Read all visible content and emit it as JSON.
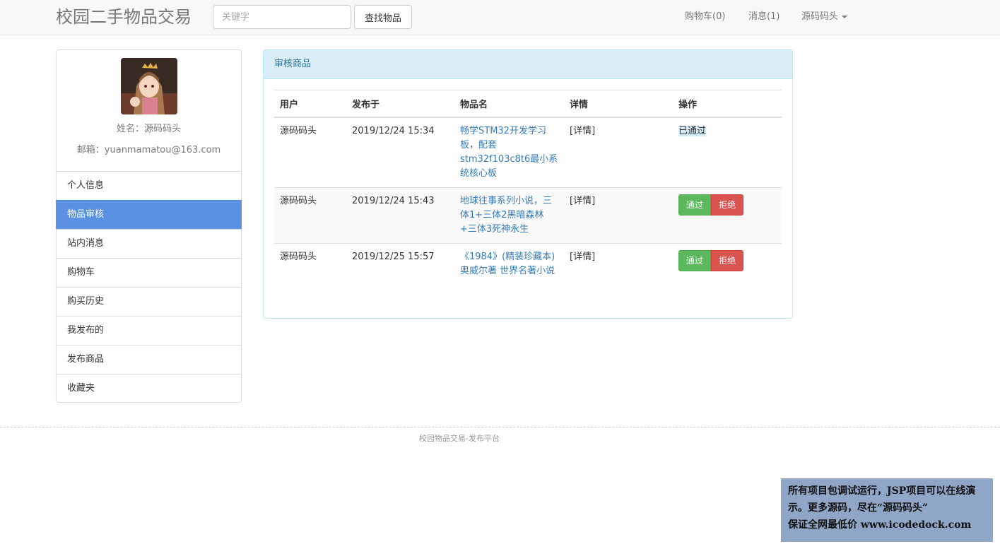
{
  "header": {
    "brand": "校园二手物品交易",
    "search_placeholder": "关键字",
    "search_button": "查找物品",
    "cart": "购物车(0)",
    "messages": "消息(1)",
    "user": "源码码头"
  },
  "profile": {
    "name_line": "姓名：源码码头",
    "email_line": "邮箱：yuanmamatou@163.com"
  },
  "sidebar": {
    "items": [
      {
        "label": "个人信息"
      },
      {
        "label": "物品审核"
      },
      {
        "label": "站内消息"
      },
      {
        "label": "购物车"
      },
      {
        "label": "购买历史"
      },
      {
        "label": "我发布的"
      },
      {
        "label": "发布商品"
      },
      {
        "label": "收藏夹"
      }
    ],
    "active_index": 1
  },
  "panel": {
    "title": "审核商品",
    "columns": [
      "用户",
      "发布于",
      "物品名",
      "详情",
      "操作"
    ],
    "rows": [
      {
        "user": "源码码头",
        "date": "2019/12/24 15:34",
        "name": "畅学STM32开发学习板，配套stm32f103c8t6最小系统核心板",
        "detail": "[详情]",
        "status": "已通过"
      },
      {
        "user": "源码码头",
        "date": "2019/12/24 15:43",
        "name": "地球往事系列小说，三体1+三体2黑暗森林+三体3死神永生",
        "detail": "[详情]",
        "approve": "通过",
        "reject": "拒绝"
      },
      {
        "user": "源码码头",
        "date": "2019/12/25 15:57",
        "name": "《1984》(精装珍藏本) 奥威尔著 世界名著小说",
        "detail": "[详情]",
        "approve": "通过",
        "reject": "拒绝"
      }
    ]
  },
  "footer": {
    "text": "校园物品交易-发布平台"
  },
  "banner": {
    "line1": "所有项目包调试运行，JSP项目可以在线演示。更多源码，尽在“源码码头”",
    "line2": "保证全网最低价 www.icodedock.com"
  },
  "colors": {
    "active": "#5a91e2",
    "panel_heading": "#d9edf7",
    "approve": "#5cb85c",
    "reject": "#d9534f",
    "link": "#337ab7"
  }
}
